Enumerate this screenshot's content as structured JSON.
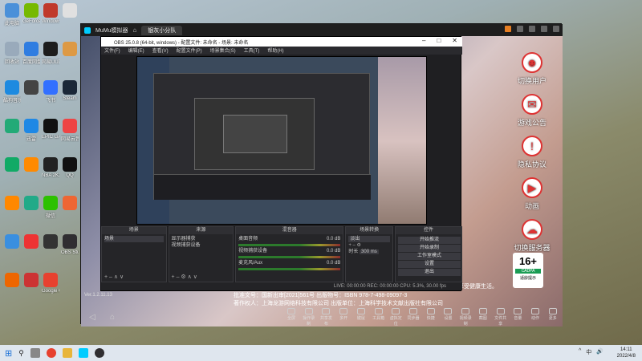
{
  "desktop": {
    "icons": [
      {
        "label": "此电脑",
        "color": "#4a90d9"
      },
      {
        "label": "GeForce Experience",
        "color": "#76b900"
      },
      {
        "label": "Windows10 Mac",
        "color": "#c0392b"
      },
      {
        "label": "",
        "color": "#e0e0e0"
      },
      {
        "label": "回收站",
        "color": "#9ab"
      },
      {
        "label": "百度网盘",
        "color": "#2f7de1"
      },
      {
        "label": "网易UU加速器",
        "color": "#1d1d1d"
      },
      {
        "label": "",
        "color": "#d94"
      },
      {
        "label": "酷狗音乐",
        "color": "#1d8ae0"
      },
      {
        "label": "",
        "color": "#444"
      },
      {
        "label": "飞书",
        "color": "#3370ff"
      },
      {
        "label": "Steam",
        "color": "#1b2838"
      },
      {
        "label": "",
        "color": "#2a7"
      },
      {
        "label": "迅雷",
        "color": "#1e88e5"
      },
      {
        "label": "EPIC GAMES",
        "color": "#111"
      },
      {
        "label": "网易云音乐",
        "color": "#e44"
      },
      {
        "label": "",
        "color": "#1a6"
      },
      {
        "label": "",
        "color": "#ff8a00"
      },
      {
        "label": "NBA 2K21",
        "color": "#222"
      },
      {
        "label": "QQ",
        "color": "#111"
      },
      {
        "label": "",
        "color": "#f80"
      },
      {
        "label": "",
        "color": "#2a8"
      },
      {
        "label": "微信",
        "color": "#2dc100"
      },
      {
        "label": "",
        "color": "#e63"
      },
      {
        "label": "",
        "color": "#3a8fe0"
      },
      {
        "label": "",
        "color": "#e33"
      },
      {
        "label": "",
        "color": "#333"
      },
      {
        "label": "OBS Studio",
        "color": "#302e31"
      },
      {
        "label": "",
        "color": "#e60"
      },
      {
        "label": "",
        "color": "#c33"
      },
      {
        "label": "Google Chrome",
        "color": "#e7412f"
      }
    ]
  },
  "mumu": {
    "app_name": "MuMu模拟器",
    "tab_label": "银灰小分队",
    "version": "Ver.1.2.11.13",
    "footer_line1": "批准文号：国新出审[2021]561号   出版物号：ISBN 978-7-498-09097-3",
    "footer_line2": "著作权人：上海龙游网络科技有限公司   出版单位：上海科学技术文献出版社有限公司",
    "health_notice": "享受健康生活。",
    "side_menu": [
      {
        "label": "切换用户",
        "icon": "switch-user-icon",
        "glyph": "☻"
      },
      {
        "label": "游戏公告",
        "icon": "announcement-icon",
        "glyph": "✉"
      },
      {
        "label": "隐私协议",
        "icon": "privacy-icon",
        "glyph": "!"
      },
      {
        "label": "动画",
        "icon": "animation-icon",
        "glyph": "▶"
      },
      {
        "label": "切换服务器",
        "icon": "server-icon",
        "glyph": "☁"
      }
    ],
    "age_rating": {
      "number": "16+",
      "tag": "CADPA",
      "label": "适龄提示"
    },
    "tools": [
      "全屏",
      "操作录制",
      "共享发布",
      "多开",
      "键鼠",
      "工具箱",
      "虚拟定位",
      "同步器",
      "快捷",
      "设置",
      "视频录制",
      "截图",
      "文件共享",
      "音量",
      "动作",
      "更多"
    ]
  },
  "obs": {
    "title": "OBS 25.0.8 (64-bit, windows) - 配置文件: 未命名 - 场景: 未命名",
    "menu": [
      "文件(F)",
      "编辑(E)",
      "查看(V)",
      "配置文件(P)",
      "场景集合(S)",
      "工具(T)",
      "帮助(H)"
    ],
    "docks": {
      "scenes": {
        "title": "场景",
        "items": [
          "场景"
        ]
      },
      "sources": {
        "title": "来源",
        "items": [
          "显示器捕获",
          "视频捕获设备"
        ]
      },
      "mixer": {
        "title": "混音器",
        "channels": [
          {
            "name": "桌面音频",
            "level": "0.0 dB"
          },
          {
            "name": "视频捕获设备",
            "level": "0.0 dB"
          },
          {
            "name": "麦克风/Aux",
            "level": "0.0 dB"
          }
        ]
      },
      "transitions": {
        "title": "场景转换",
        "type": "淡出",
        "duration_label": "时长",
        "duration": "300 ms"
      },
      "controls": {
        "title": "控件",
        "buttons": [
          "开始推流",
          "开始录制",
          "工作室模式",
          "设置",
          "退出"
        ]
      }
    },
    "status": "LIVE: 00:00:00   REC: 00:00:00   CPU: 5.3%, 30.00 fps"
  },
  "taskbar": {
    "time": "14:11",
    "date": "2022/4/8",
    "tray": [
      "^",
      "中",
      "🔊"
    ]
  }
}
